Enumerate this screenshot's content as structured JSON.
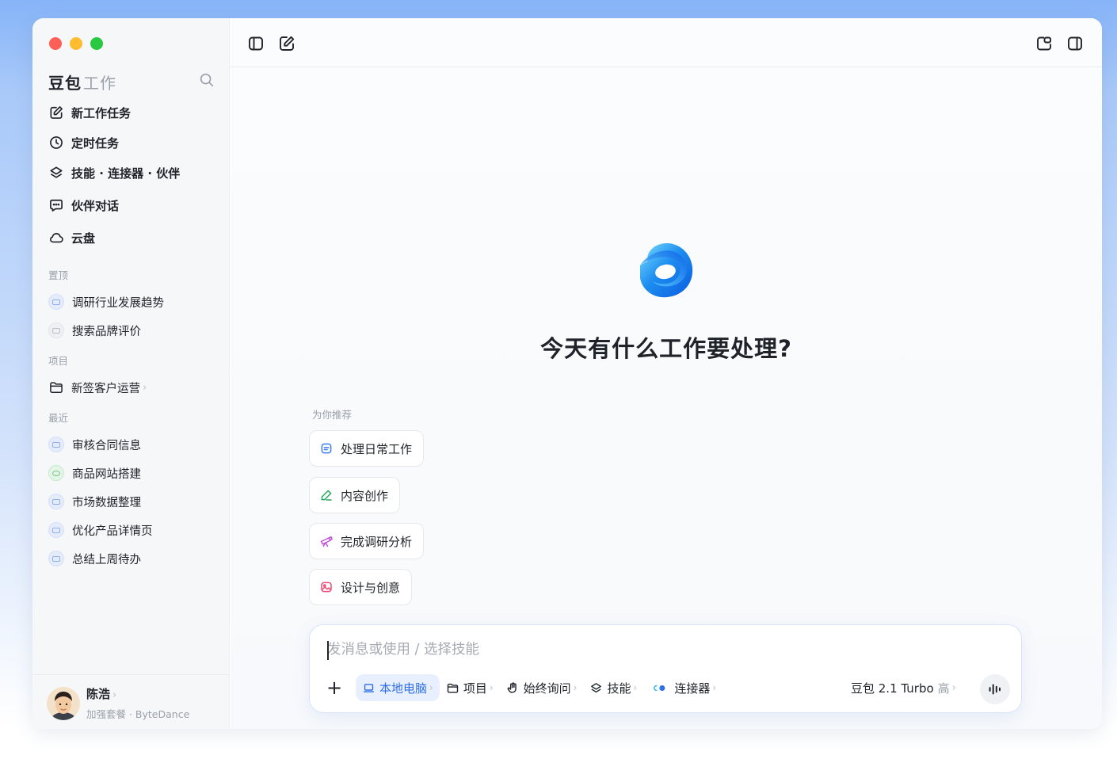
{
  "window": {
    "traffic_lights": [
      "close",
      "minimize",
      "maximize"
    ]
  },
  "sidebar": {
    "brand": "豆包",
    "brand_sub": "工作",
    "search_icon": "search-icon",
    "nav": [
      {
        "label": "新工作任务",
        "icon": "edit-icon"
      },
      {
        "label": "定时任务",
        "icon": "clock-icon"
      },
      {
        "label": "技能 · 连接器 · 伙伴",
        "icon": "layers-icon"
      },
      {
        "label": "伙伴对话",
        "icon": "chat-bubble-icon"
      },
      {
        "label": "云盘",
        "icon": "cloud-icon"
      }
    ],
    "pinned_label": "置顶",
    "pinned": [
      "调研行业发展趋势",
      "搜索品牌评价"
    ],
    "projects_label": "项目",
    "projects": [
      {
        "label": "新签客户运营",
        "chevron": "›"
      }
    ],
    "recent_label": "最近",
    "recent": [
      "审核合同信息",
      "商品网站搭建",
      "市场数据整理",
      "优化产品详情页",
      "总结上周待办"
    ],
    "user": {
      "name": "陈浩",
      "name_chevron": "›",
      "subtitle": "加强套餐 · ByteDance"
    }
  },
  "topbar": {
    "left_icons": [
      "sidebar-toggle-icon",
      "new-chat-icon"
    ],
    "right_icons": [
      "share-window-icon",
      "panel-toggle-icon"
    ]
  },
  "main": {
    "headline": "今天有什么工作要处理?",
    "recommend_label": "为你推荐",
    "recommendations": [
      {
        "label": "处理日常工作",
        "icon": "document-icon",
        "color": "#3b7cf0"
      },
      {
        "label": "内容创作",
        "icon": "pen-icon",
        "color": "#26a65b"
      },
      {
        "label": "完成调研分析",
        "icon": "telescope-icon",
        "color": "#c14fd6"
      },
      {
        "label": "设计与创意",
        "icon": "image-icon",
        "color": "#e94d78"
      }
    ]
  },
  "composer": {
    "placeholder": "发消息或使用 / 选择技能",
    "value": "",
    "plus": "+",
    "tools": [
      {
        "label": "本地电脑",
        "icon": "laptop-icon",
        "active": true
      },
      {
        "label": "项目",
        "icon": "folder-icon",
        "active": false
      },
      {
        "label": "始终询问",
        "icon": "hand-icon",
        "active": false
      },
      {
        "label": "技能",
        "icon": "layers-icon",
        "active": false
      },
      {
        "label": "连接器",
        "icon": "connector-icon",
        "active": false
      }
    ],
    "chevron": "›",
    "model": {
      "name": "豆包 2.1 Turbo",
      "level": "高"
    },
    "voice_icon": "voice-wave-icon"
  },
  "colors": {
    "accent": "#2f6ee6",
    "active_chip_bg": "#e8f0ff",
    "traffic_close": "#fe5f57",
    "traffic_min": "#febc2e",
    "traffic_max": "#28c840"
  }
}
